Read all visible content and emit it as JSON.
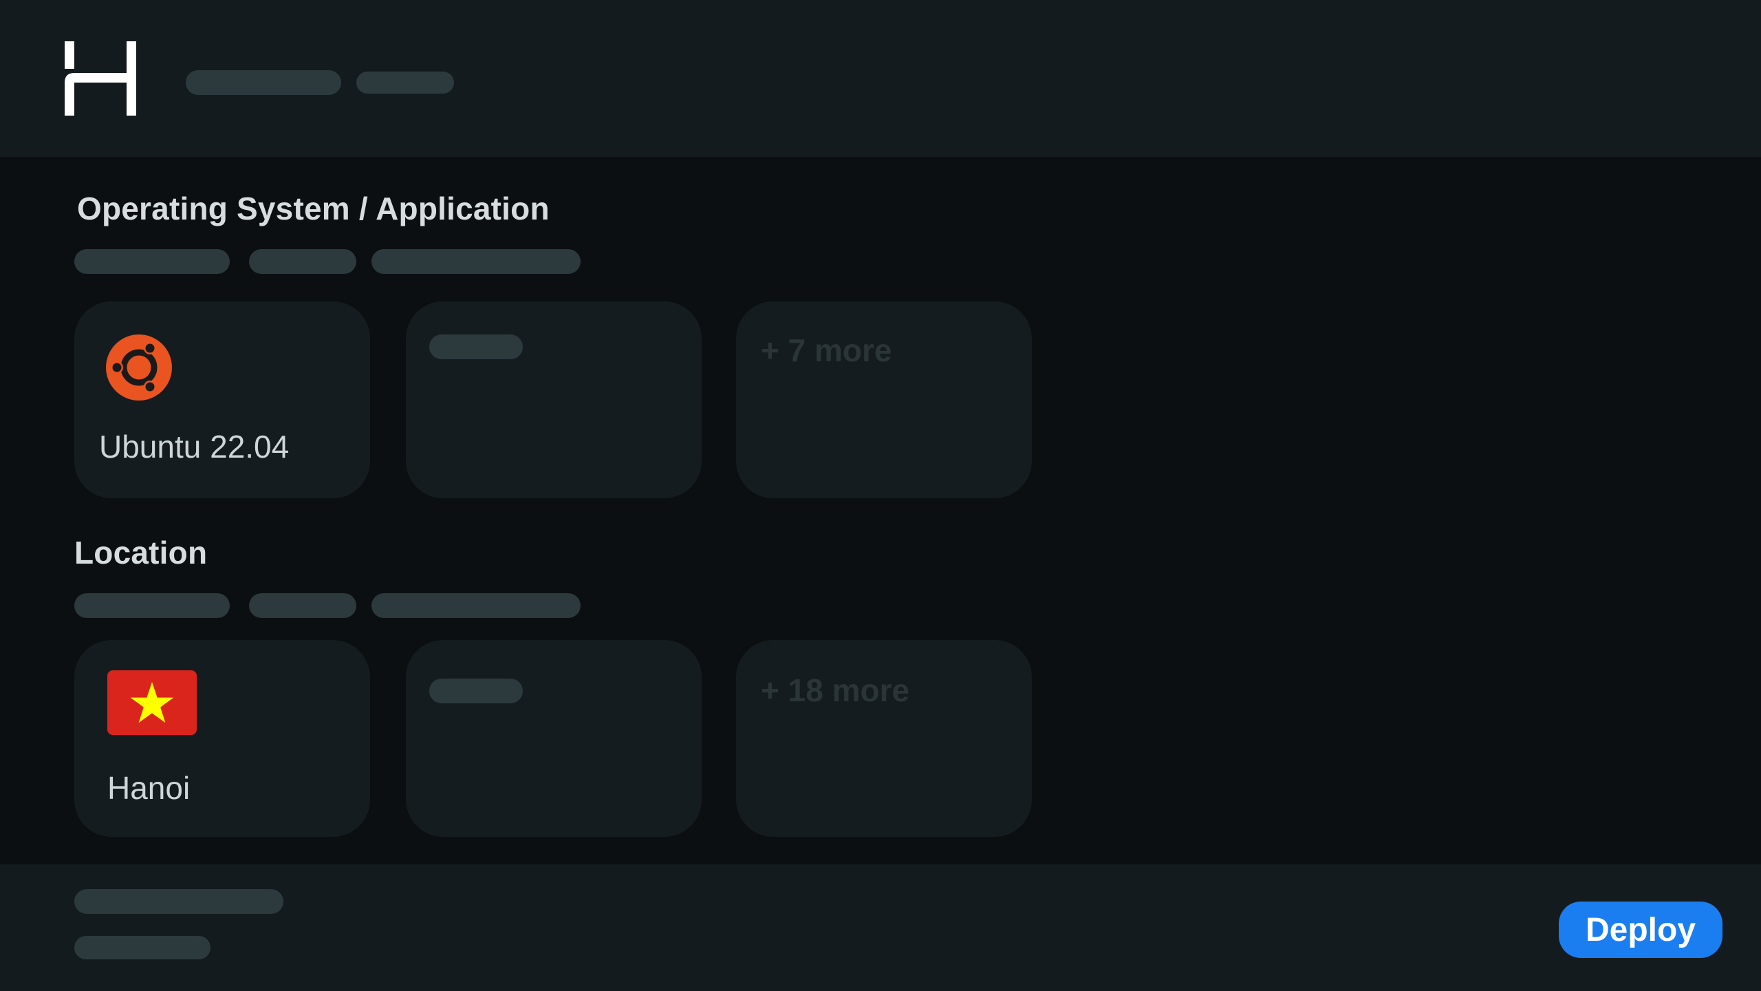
{
  "header": {
    "logo_icon": "h-logo-icon"
  },
  "os_section": {
    "title": "Operating System / Application",
    "cards": [
      {
        "icon": "ubuntu-icon",
        "label": "Ubuntu 22.04",
        "icon_color": "#e95420"
      },
      {
        "placeholder": true
      },
      {
        "more_label": "+ 7 more"
      }
    ]
  },
  "location_section": {
    "title": "Location",
    "cards": [
      {
        "icon": "vietnam-flag-icon",
        "label": "Hanoi",
        "flag_colors": [
          "#da251d",
          "#ffff00"
        ]
      },
      {
        "placeholder": true
      },
      {
        "more_label": "+ 18 more"
      }
    ]
  },
  "footer": {
    "deploy_label": "Deploy"
  },
  "colors": {
    "background": "#0b0f11",
    "panel": "#141b1e",
    "card": "#151c1f",
    "skeleton": "#2c3a3e",
    "accent": "#1a7ef0"
  }
}
